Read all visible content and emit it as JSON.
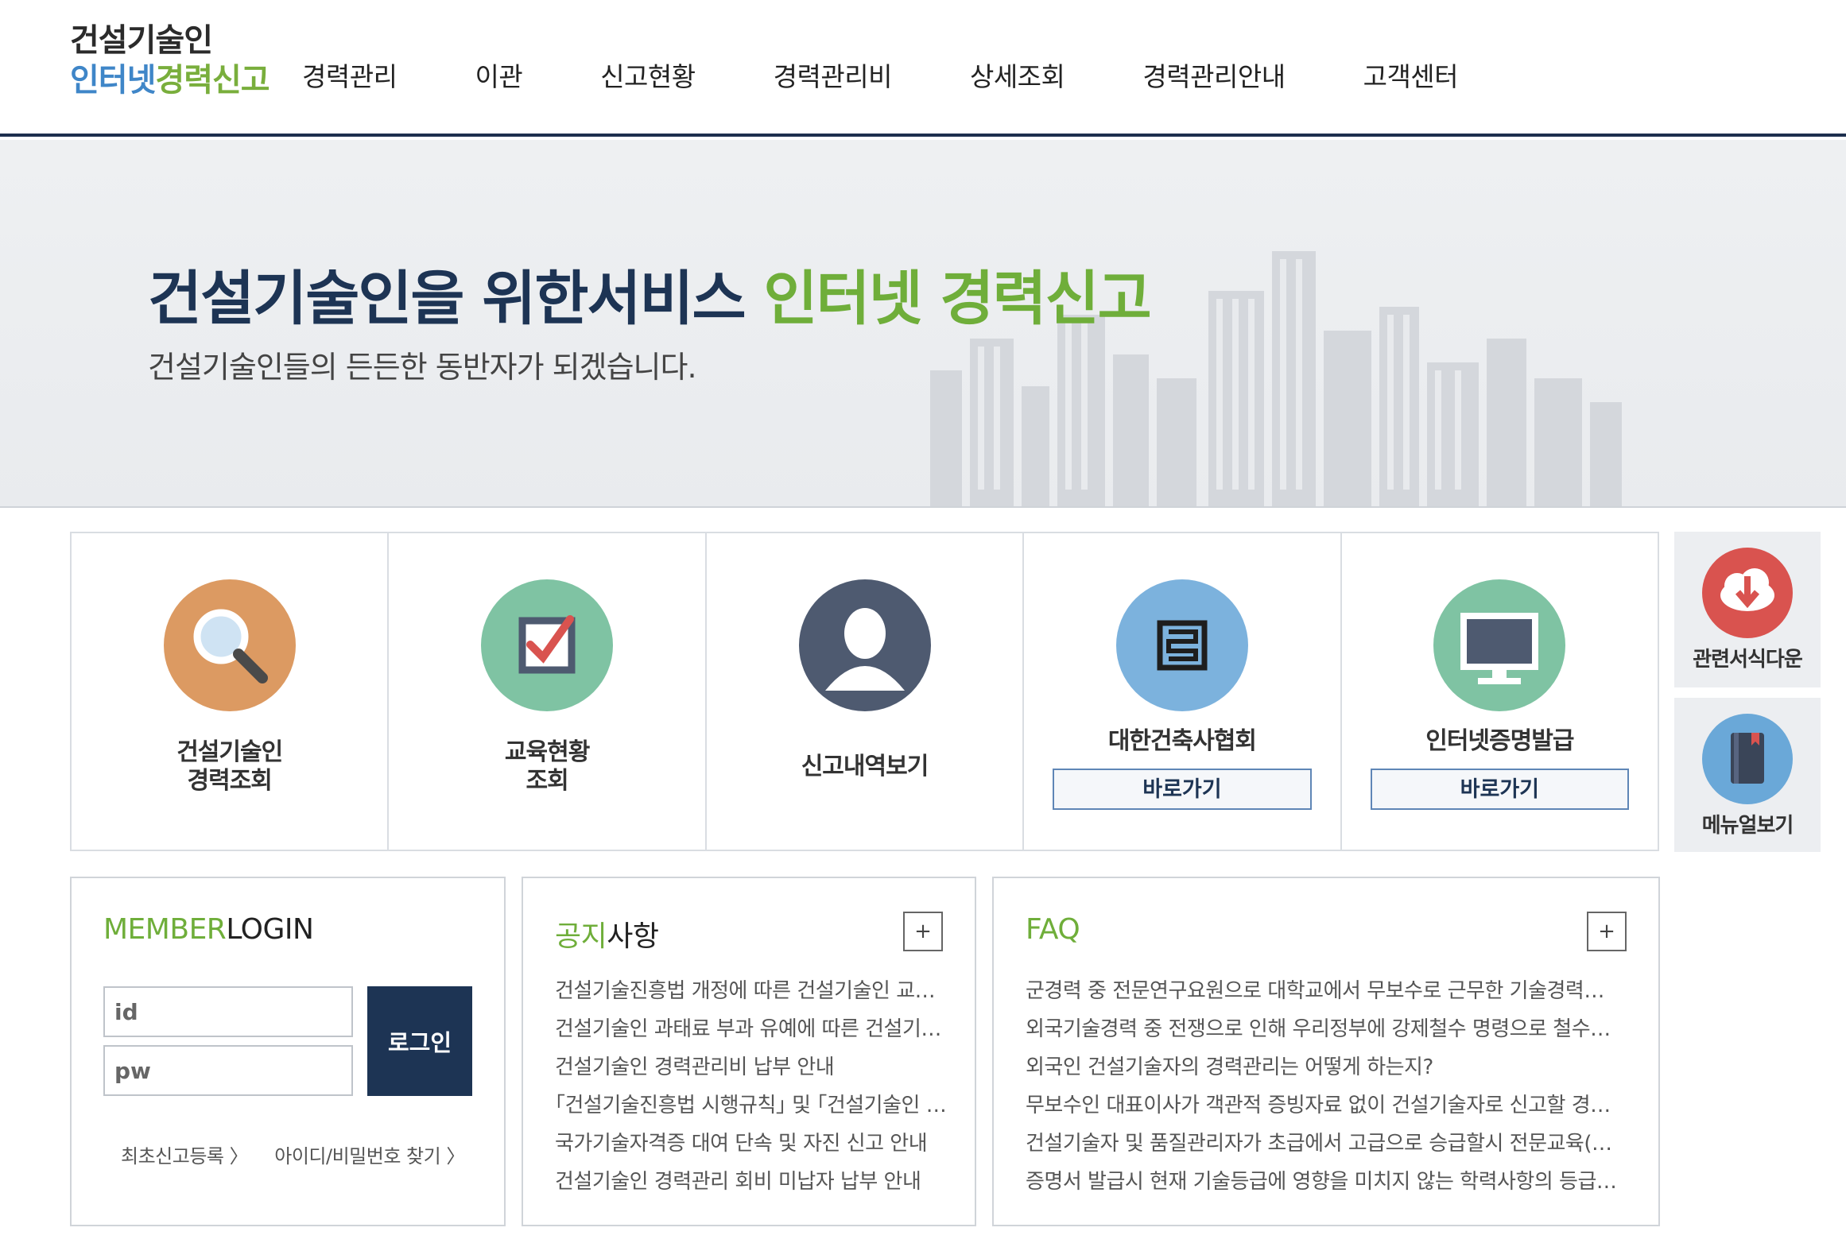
{
  "logo": {
    "line1": "건설기술인",
    "line2_blue": "인터넷",
    "line2_green": "경력신고"
  },
  "nav": [
    "경력관리",
    "이관",
    "신고현황",
    "경력관리비",
    "상세조회",
    "경력관리안내",
    "고객센터"
  ],
  "hero": {
    "title_dark": "건설기술인을 위한서비스 ",
    "title_green": "인터넷 경력신고",
    "subtitle": "건설기술인들의 든든한 동반자가 되겠습니다."
  },
  "quick_menu": [
    {
      "line1": "건설기술인",
      "line2": "경력조회",
      "icon": "search-icon",
      "color": "#dc9a62"
    },
    {
      "line1": "교육현황",
      "line2": "조회",
      "icon": "checkbox-icon",
      "color": "#7fc3a3"
    },
    {
      "line1": "신고내역보기",
      "line2": "",
      "icon": "user-icon",
      "color": "#4e5a70"
    },
    {
      "line1": "대한건축사협회",
      "button": "바로가기",
      "icon": "architect-logo-icon",
      "color": "#7cb2dd"
    },
    {
      "line1": "인터넷증명발급",
      "button": "바로가기",
      "icon": "monitor-icon",
      "color": "#7fc3a3"
    }
  ],
  "side_links": [
    {
      "label": "관련서식다운",
      "icon": "download-icon",
      "color": "#d9534f"
    },
    {
      "label": "메뉴얼보기",
      "icon": "manual-book-icon",
      "color": "#6aa8d8"
    }
  ],
  "login": {
    "title_green": "MEMBER",
    "title_dark": "LOGIN",
    "id_placeholder": "id",
    "pw_placeholder": "pw",
    "button": "로그인",
    "register": "최초신고등록 〉",
    "find": "아이디/비밀번호 찾기 〉"
  },
  "notice": {
    "title_green": "공지",
    "title_dark": "사항",
    "more": "+",
    "items": [
      "건설기술진흥법 개정에 따른 건설기술인 교…",
      "건설기술인 과태료 부과 유예에 따른 건설기…",
      "건설기술인 경력관리비 납부 안내",
      "｢건설기술진흥법 시행규칙｣ 및 ｢건설기술인 …",
      "국가기술자격증 대여 단속 및 자진 신고 안내",
      "건설기술인 경력관리 회비 미납자 납부 안내"
    ]
  },
  "faq": {
    "title": "FAQ",
    "more": "+",
    "items": [
      "군경력 중 전문연구요원으로 대학교에서 무보수로 근무한 기술경력…",
      "외국기술경력 중 전쟁으로 인해 우리정부에 강제철수 명령으로 철수…",
      "외국인 건설기술자의 경력관리는 어떻게 하는지?",
      "무보수인 대표이사가 객관적 증빙자료 없이 건설기술자로 신고할 경…",
      "건설기술자 및 품질관리자가 초급에서 고급으로 승급할시 전문교육(…",
      "증명서 발급시 현재 기술등급에 영향을 미치지 않는 학력사항의 등급…"
    ]
  }
}
